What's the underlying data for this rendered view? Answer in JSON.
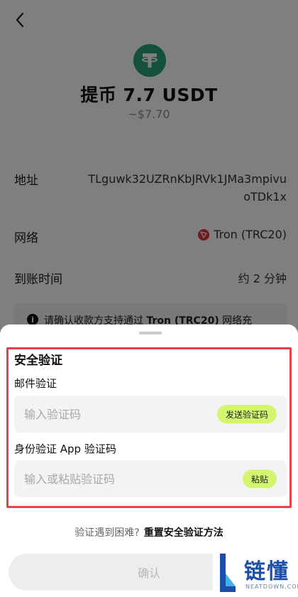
{
  "header": {
    "title": "提币 7.7 USDT",
    "fiat_value": "~$7.70"
  },
  "details": {
    "address_label": "地址",
    "address_value": "TLguwk32UZRnKbJRVk1JMa3mpivuoTDk1x",
    "network_label": "网络",
    "network_value": "Tron (TRC20)",
    "arrival_label": "到账时间",
    "arrival_value": "约 2 分钟"
  },
  "notice": {
    "prefix": "请确认收款方支持通过 ",
    "network": "Tron (TRC20)",
    "suffix": " 网络充"
  },
  "security": {
    "title": "安全验证",
    "email_label": "邮件验证",
    "email_placeholder": "输入验证码",
    "send_code_label": "发送验证码",
    "app_label": "身份验证 App 验证码",
    "app_placeholder": "输入或粘贴验证码",
    "paste_label": "粘贴"
  },
  "help": {
    "question": "验证遇到困难?",
    "reset_link": "重置安全验证方法"
  },
  "confirm_label": "确认",
  "watermark": {
    "title": "链懂",
    "subtitle": "NEATDOWN.COM"
  },
  "colors": {
    "accent_green": "#d4f570",
    "usdt_green": "#26a17b",
    "tron_red": "#e0313b",
    "highlight_red": "#e8414a"
  }
}
